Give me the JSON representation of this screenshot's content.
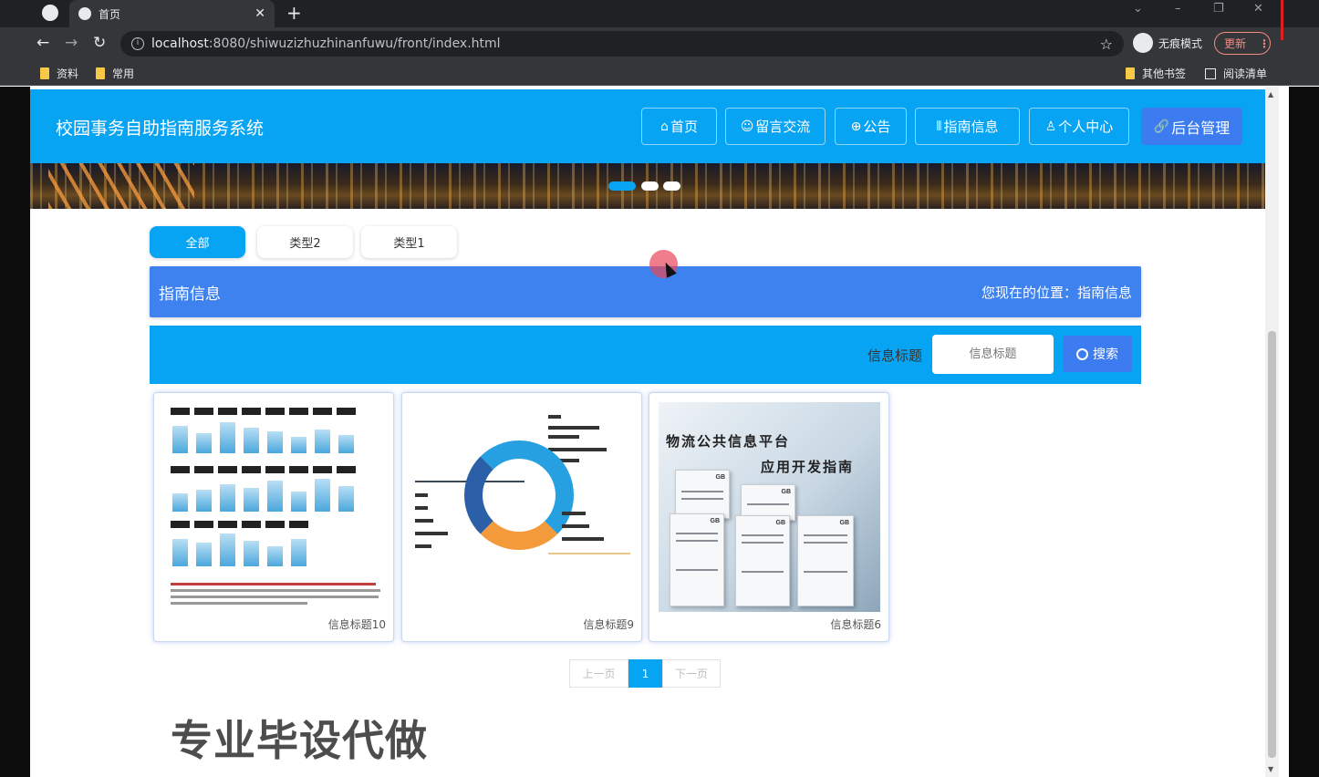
{
  "browser": {
    "tab_title": "首页",
    "url_host": "localhost",
    "url_rest": ":8080/shiwuzizhuzhinanfuwu/front/index.html",
    "incognito_label": "无痕模式",
    "update_label": "更新",
    "bookmarks": [
      "资料",
      "常用"
    ],
    "other_bookmarks": "其他书签",
    "reading_list": "阅读清单"
  },
  "site": {
    "title": "校园事务自助指南服务系统",
    "nav": [
      {
        "label": "首页",
        "icon": "home-icon",
        "glyph": "⌂"
      },
      {
        "label": "留言交流",
        "icon": "chat-icon",
        "glyph": "☺"
      },
      {
        "label": "公告",
        "icon": "globe-icon",
        "glyph": "⊕"
      },
      {
        "label": "指南信息",
        "icon": "grid-icon",
        "glyph": "⫴"
      },
      {
        "label": "个人中心",
        "icon": "user-icon",
        "glyph": "♙"
      },
      {
        "label": "后台管理",
        "icon": "link-icon",
        "glyph": "🔗"
      }
    ]
  },
  "filters": [
    "全部",
    "类型2",
    "类型1"
  ],
  "section": {
    "title": "指南信息",
    "location": "您现在的位置：指南信息"
  },
  "search": {
    "label": "信息标题",
    "placeholder": "信息标题",
    "button": "搜索"
  },
  "cards": [
    {
      "caption": "信息标题10"
    },
    {
      "caption": "信息标题9"
    },
    {
      "caption": "信息标题6",
      "cover_line1": "物流公共信息平台",
      "cover_line2": "应用开发指南",
      "book_mark": "GB"
    }
  ],
  "pager": {
    "prev": "上一页",
    "current": "1",
    "next": "下一页"
  },
  "watermark": "专业毕设代做",
  "colors": {
    "header": "#07a4f4",
    "accent": "#3d82ee",
    "admin": "#3d7cf0"
  }
}
